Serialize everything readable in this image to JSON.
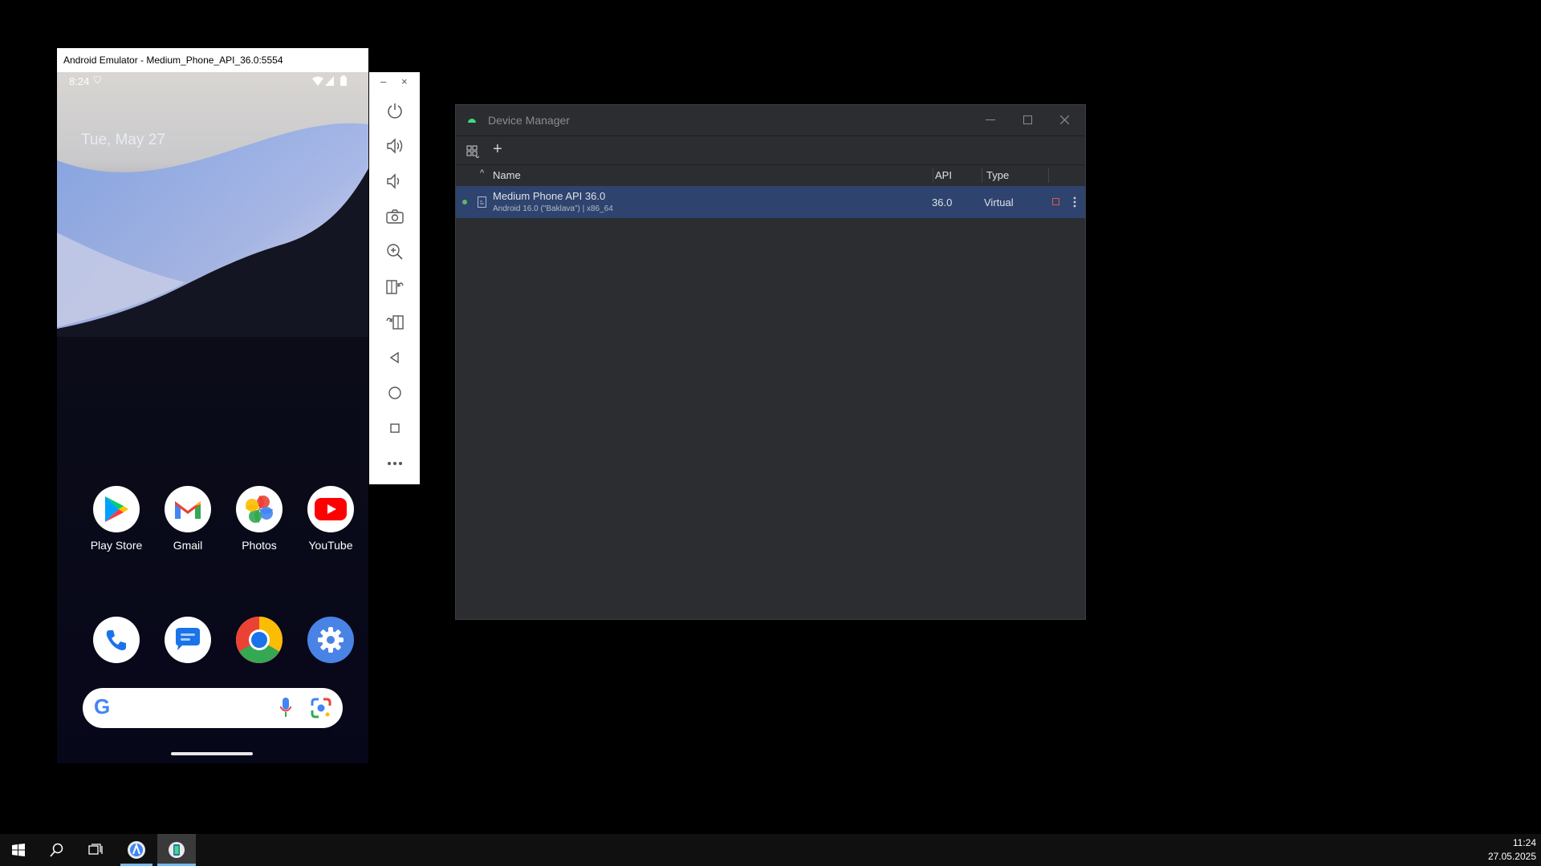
{
  "emulator": {
    "title": "Android Emulator - Medium_Phone_API_36.0:5554",
    "status_time": "8:24",
    "date": "Tue, May 27",
    "apps": [
      {
        "label": "Play Store",
        "icon": "play-store-icon"
      },
      {
        "label": "Gmail",
        "icon": "gmail-icon"
      },
      {
        "label": "Photos",
        "icon": "photos-icon"
      },
      {
        "label": "YouTube",
        "icon": "youtube-icon"
      }
    ],
    "dock": [
      "phone-icon",
      "messages-icon",
      "chrome-icon",
      "settings-icon"
    ],
    "toolbar": [
      "power-icon",
      "volume-up-icon",
      "volume-down-icon",
      "camera-icon",
      "zoom-icon",
      "rotate-left-icon",
      "rotate-right-icon",
      "back-icon",
      "home-icon",
      "overview-icon",
      "more-icon"
    ],
    "window_controls": {
      "minimize": "–",
      "close": "×"
    }
  },
  "device_manager": {
    "title": "Device Manager",
    "columns": {
      "name": "Name",
      "api": "API",
      "type": "Type"
    },
    "devices": [
      {
        "name": "Medium Phone API 36.0",
        "details": "Android 16.0 (\"Baklava\") | x86_64",
        "api": "36.0",
        "type": "Virtual",
        "status": "running"
      }
    ],
    "add_label": "+"
  },
  "taskbar": {
    "time": "11:24",
    "date": "27.05.2025"
  },
  "colors": {
    "selection": "#2e436e",
    "running_dot": "#5fb865",
    "stop_red": "#e05a4a"
  }
}
